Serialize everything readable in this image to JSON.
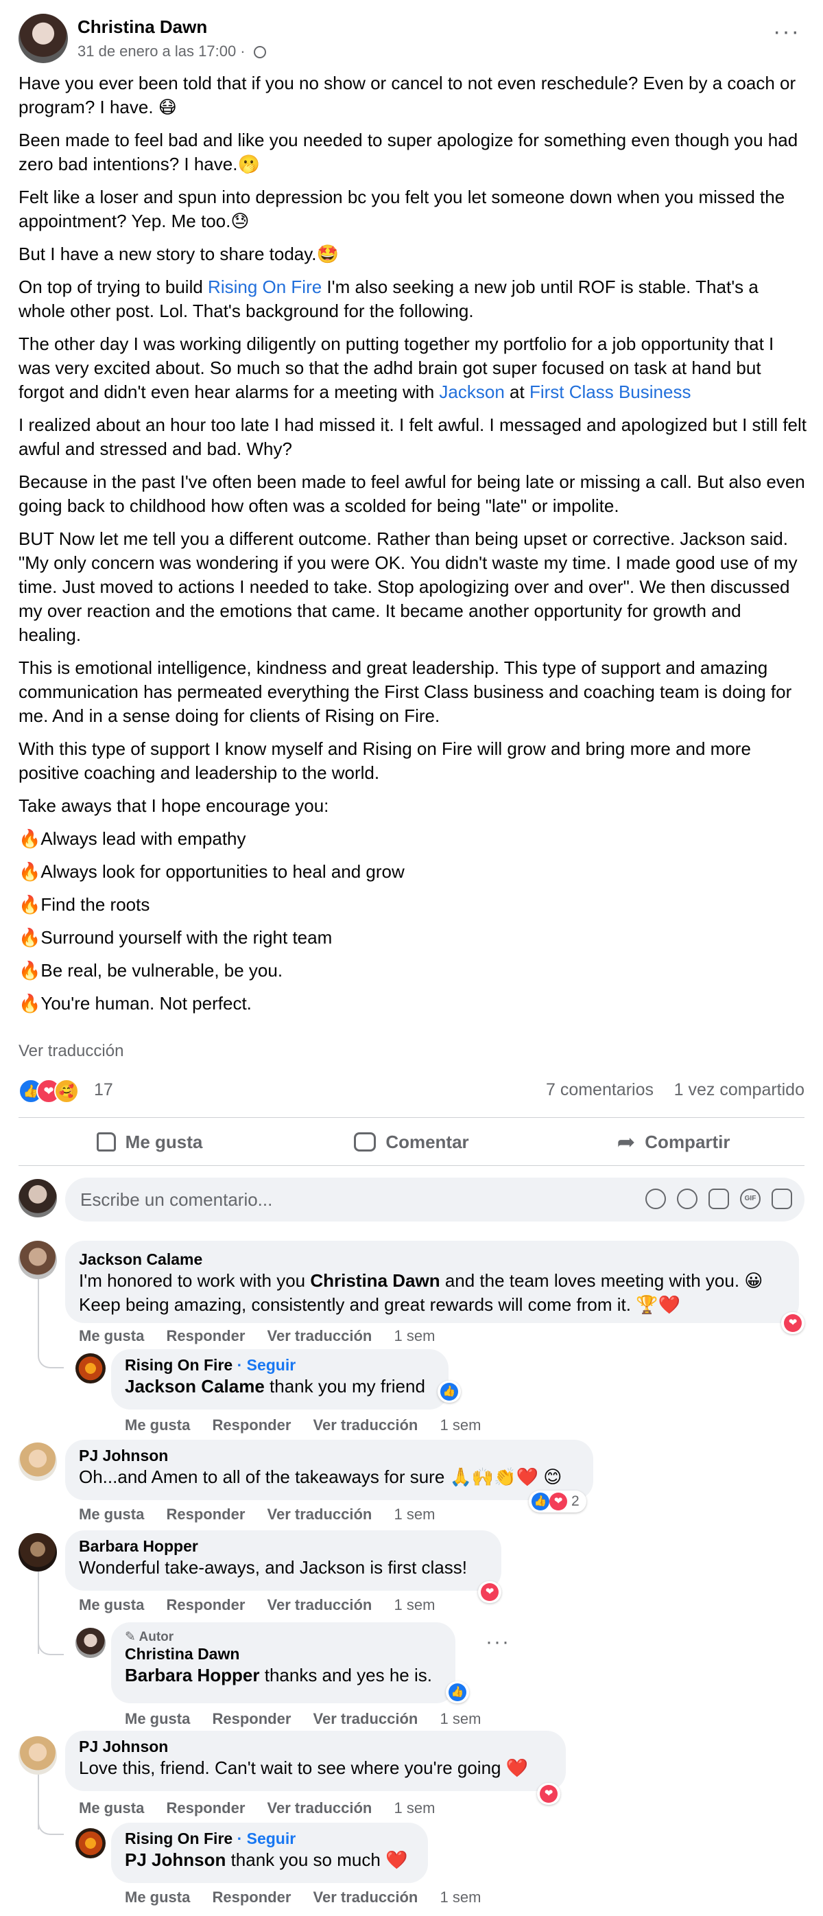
{
  "post": {
    "author": "Christina Dawn",
    "timestamp": "31 de enero a las 17:00 ·",
    "privacy_icon": "globe-icon",
    "more_label": "···",
    "paragraphs": [
      "Have you ever been told that if you no show or cancel to not even reschedule? Even by a coach or program?     I have. 😷",
      "Been made to feel bad and like you needed to super apologize for something even though you had zero bad intentions?      I have.🫢",
      "Felt like a loser and spun into depression bc you felt you let someone down when you missed the appointment?    Yep. Me too.😓",
      "But I have a new story to share today.🤩"
    ],
    "p5": {
      "before": "On top of trying to build ",
      "link": "Rising On Fire",
      "after": " I'm also seeking a new job until ROF is stable. That's a whole other post. Lol. That's background for the following."
    },
    "p6": {
      "before": "The other day I was working diligently on putting together my portfolio for a job opportunity that I was very excited about. So much so that the adhd brain got super focused on task at hand but forgot and didn't even hear alarms for a meeting with ",
      "link1": "Jackson",
      "middle": " at ",
      "link2": "First Class Business"
    },
    "paragraphs_b": [
      "I realized about an hour too late I had missed it. I felt awful. I messaged and apologized but I still felt awful and stressed and bad.     Why?",
      "Because in the past I've often been made to feel awful for being late or missing a call. But also even going back to childhood how often was a scolded for being \"late\" or impolite.",
      "BUT Now let me tell you a different outcome. Rather than being upset or corrective. Jackson said. \"My only concern was wondering if you were OK.  You didn't waste my time. I made good use of my time. Just moved to actions I needed to take. Stop apologizing over and over\". We then discussed my over reaction and the emotions that came. It became another opportunity for growth and healing.",
      "This is emotional intelligence, kindness and great leadership. This type of support and amazing communication has permeated everything the First Class business and coaching team is doing for me.    And in a sense doing for clients of Rising on Fire.",
      "With this type of support I know myself and Rising on Fire will grow and bring more and more positive coaching and leadership to the world.",
      "Take aways that I hope encourage you:"
    ],
    "fire_emoji": "🔥",
    "takeaways": [
      "Always lead with empathy",
      "Always look for opportunities to heal and grow",
      "Find the roots",
      "Surround yourself with the right team",
      "Be real, be vulnerable, be you.",
      "You're human. Not perfect."
    ],
    "see_translation": "Ver traducción"
  },
  "reactions": {
    "count": "17",
    "comments": "7 comentarios",
    "shares": "1 vez compartido",
    "like_glyph": "👍",
    "love_glyph": "❤",
    "care_glyph": "🥰"
  },
  "actions": {
    "like": "Me gusta",
    "comment": "Comentar",
    "share": "Compartir",
    "share_glyph": "➦"
  },
  "composer": {
    "placeholder": "Escribe un comentario...",
    "gif_label": "GIF"
  },
  "links": {
    "like": "Me gusta",
    "reply": "Responder",
    "translate": "Ver traducción",
    "time": "1 sem"
  },
  "comments": {
    "c1": {
      "name": "Jackson Calame",
      "pre": "I'm honored to work with you ",
      "mention": "Christina Dawn",
      "post": " and the team loves meeting with you. 😀 Keep being amazing, consistently and great rewards will come from it. 🏆❤️"
    },
    "r1": {
      "name": "Rising On Fire",
      "follow": "· Seguir",
      "mention": "Jackson Calame",
      "post": " thank you my friend"
    },
    "c2": {
      "name": "PJ Johnson",
      "text": "Oh...and Amen to all of the takeaways for sure 🙏🙌👏❤️ 😊",
      "react_count": "2"
    },
    "c3": {
      "name": "Barbara Hopper",
      "text": "Wonderful take-aways, and Jackson is first class!"
    },
    "r3": {
      "badge": "Autor",
      "name": "Christina Dawn",
      "mention": "Barbara Hopper",
      "post": " thanks and yes he is."
    },
    "c4": {
      "name": "PJ Johnson",
      "text": "Love this, friend. Can't wait to see where you're going ❤️"
    },
    "r4": {
      "name": "Rising On Fire",
      "follow": "· Seguir",
      "mention": "PJ Johnson",
      "post": " thank you so much ❤️"
    }
  },
  "colors": {
    "link": "#216fdb",
    "secondary_text": "#65676b",
    "bubble": "#f0f2f5",
    "like_blue": "#1877f2",
    "love_red": "#f33e58"
  }
}
